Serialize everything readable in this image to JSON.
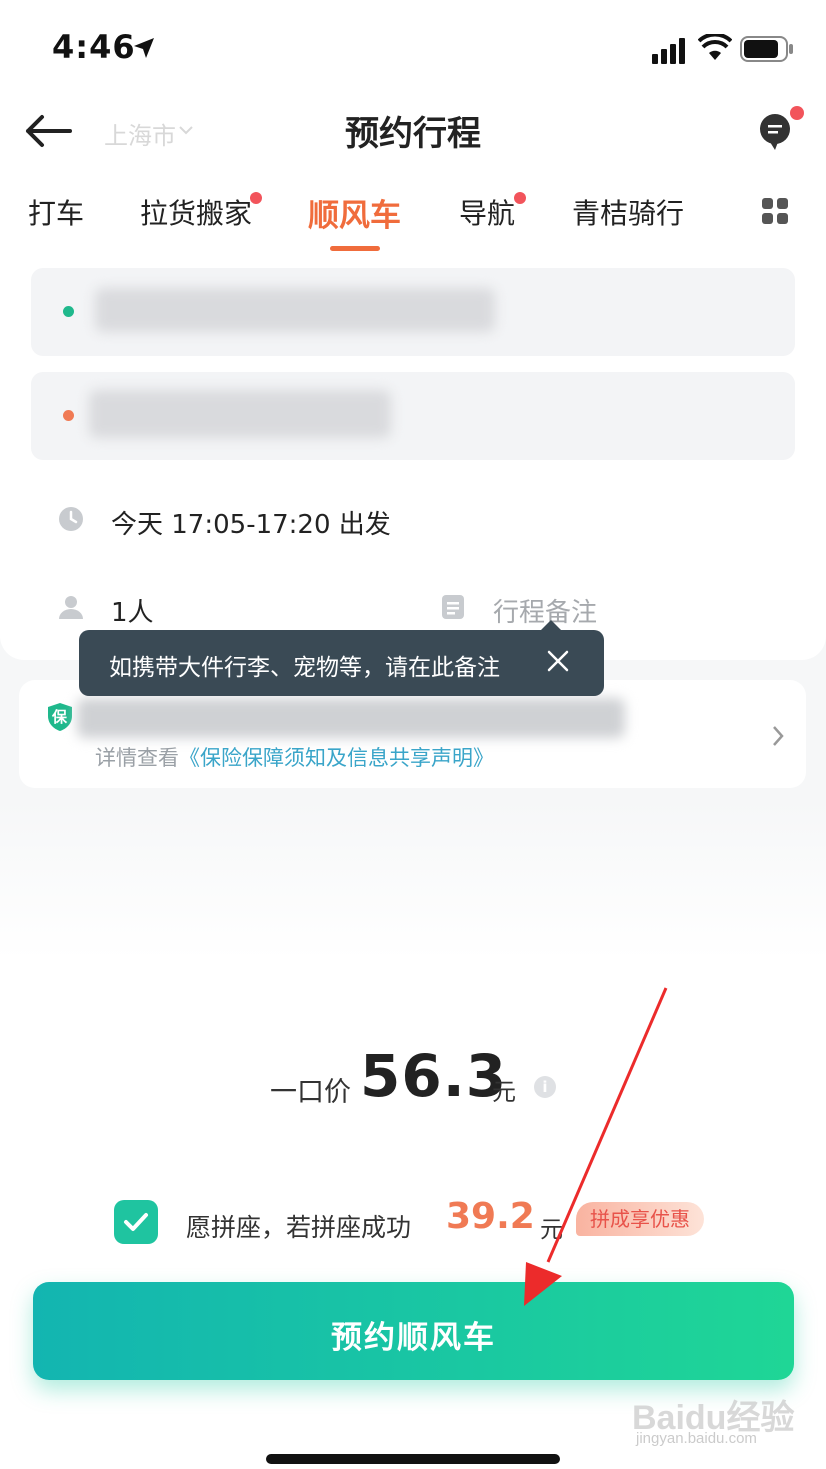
{
  "status_bar": {
    "time": "4:46"
  },
  "header": {
    "title": "预约行程",
    "city": "上海市"
  },
  "tabs": [
    {
      "label": "打车"
    },
    {
      "label": "拉货搬家"
    },
    {
      "label": "顺风车"
    },
    {
      "label": "导航"
    },
    {
      "label": "青桔骑行"
    }
  ],
  "trip": {
    "time_text": "今天 17:05-17:20 出发",
    "passengers": "1人",
    "note_placeholder": "行程备注"
  },
  "tooltip": {
    "text": "如携带大件行李、宠物等，请在此备注"
  },
  "insurance": {
    "badge": "保",
    "detail_prefix": "详情查看",
    "detail_link": "《保险保障须知及信息共享声明》"
  },
  "price": {
    "label": "一口价",
    "value": "56.3",
    "unit": "元",
    "info": "i"
  },
  "carpool": {
    "text": "愿拼座，若拼座成功",
    "price": "39.2",
    "unit": "元",
    "badge": "拼成享优惠"
  },
  "book_button": {
    "label": "预约顺风车"
  },
  "watermark": {
    "text": "Baidu经验",
    "sub": "jingyan.baidu.com"
  },
  "colors": {
    "accent": "#f06c3c",
    "primary_green": "#1fc4a0",
    "tooltip_bg": "#3a4a55"
  }
}
